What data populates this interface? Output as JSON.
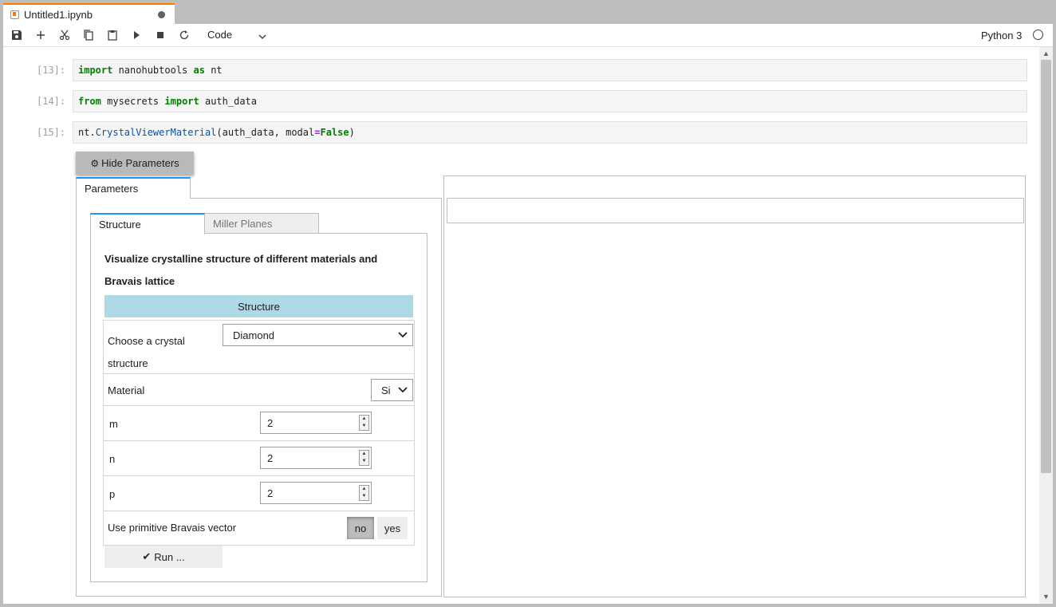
{
  "tab": {
    "title": "Untitled1.ipynb"
  },
  "toolbar": {
    "cell_type": "Code",
    "kernel": "Python 3"
  },
  "cells": [
    {
      "prompt": "[13]:",
      "tokens": [
        {
          "t": "import",
          "c": "kw"
        },
        {
          "t": " nanohubtools ",
          "c": ""
        },
        {
          "t": "as",
          "c": "kw"
        },
        {
          "t": " nt",
          "c": ""
        }
      ]
    },
    {
      "prompt": "[14]:",
      "tokens": [
        {
          "t": "from",
          "c": "kw"
        },
        {
          "t": " mysecrets ",
          "c": ""
        },
        {
          "t": "import",
          "c": "kw"
        },
        {
          "t": " auth_data",
          "c": ""
        }
      ]
    },
    {
      "prompt": "[15]:",
      "tokens": [
        {
          "t": "nt.",
          "c": ""
        },
        {
          "t": "CrystalViewerMaterial",
          "c": "fn"
        },
        {
          "t": "(auth_data, modal",
          "c": ""
        },
        {
          "t": "=",
          "c": "op"
        },
        {
          "t": "False",
          "c": "kw"
        },
        {
          "t": ")",
          "c": ""
        }
      ]
    }
  ],
  "widget": {
    "hide_button": "Hide Parameters",
    "outer_tab": "Parameters",
    "inner_tabs": [
      "Structure",
      "Miller Planes"
    ],
    "description_line1": "Visualize crystalline structure of different materials and",
    "description_line2": "Bravais lattice",
    "section_title": "Structure",
    "crystal": {
      "label_line1": "Choose a crystal",
      "label_line2": "structure",
      "value": "Diamond"
    },
    "material": {
      "label": "Material",
      "value": "Si"
    },
    "m": {
      "label": "m",
      "value": "2"
    },
    "n": {
      "label": "n",
      "value": "2"
    },
    "p": {
      "label": "p",
      "value": "2"
    },
    "primitive": {
      "label": "Use primitive Bravais vector",
      "options": [
        "no",
        "yes"
      ],
      "selected": "no"
    },
    "run_button": "Run ..."
  }
}
